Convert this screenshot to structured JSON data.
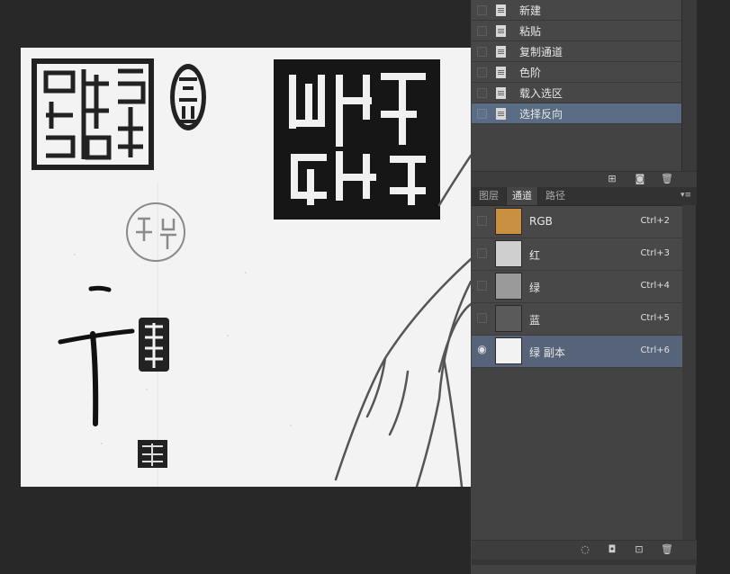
{
  "history": {
    "items": [
      {
        "label": "新建",
        "selected": false
      },
      {
        "label": "粘贴",
        "selected": false
      },
      {
        "label": "复制通道",
        "selected": false
      },
      {
        "label": "色阶",
        "selected": false
      },
      {
        "label": "载入选区",
        "selected": false
      },
      {
        "label": "选择反向",
        "selected": true
      }
    ],
    "footer_icons": [
      "new-document-from-state-icon",
      "camera-snapshot-icon",
      "trash-icon"
    ]
  },
  "tabs": [
    {
      "label": "图层",
      "active": false
    },
    {
      "label": "通道",
      "active": true
    },
    {
      "label": "路径",
      "active": false
    }
  ],
  "channels": [
    {
      "name": "RGB",
      "shortcut": "Ctrl+2",
      "visible": false,
      "selected": false,
      "thumb_color": "#c9903f"
    },
    {
      "name": "红",
      "shortcut": "Ctrl+3",
      "visible": false,
      "selected": false,
      "thumb_color": "#cfcfcf"
    },
    {
      "name": "绿",
      "shortcut": "Ctrl+4",
      "visible": false,
      "selected": false,
      "thumb_color": "#9a9a9a"
    },
    {
      "name": "蓝",
      "shortcut": "Ctrl+5",
      "visible": false,
      "selected": false,
      "thumb_color": "#5a5a5a"
    },
    {
      "name": "绿 副本",
      "shortcut": "Ctrl+6",
      "visible": true,
      "selected": true,
      "thumb_color": "#f2f2f2"
    }
  ],
  "channel_footer_icons": [
    "load-selection-icon",
    "save-selection-icon",
    "new-channel-icon",
    "trash-icon"
  ],
  "colors": {
    "selection": "#566378",
    "panel": "#434343",
    "background": "#282828"
  }
}
